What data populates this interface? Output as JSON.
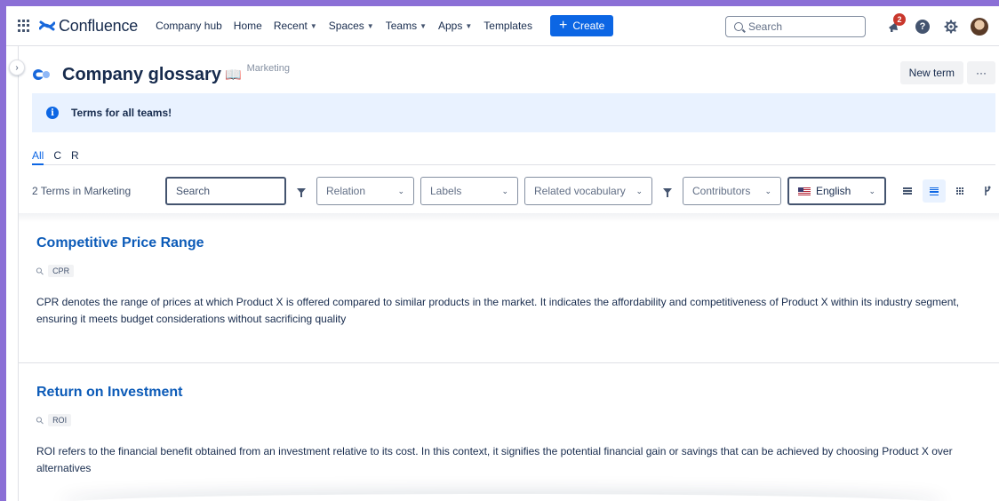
{
  "nav": {
    "brand": "Confluence",
    "items": [
      {
        "label": "Company hub",
        "dropdown": false
      },
      {
        "label": "Home",
        "dropdown": false
      },
      {
        "label": "Recent",
        "dropdown": true
      },
      {
        "label": "Spaces",
        "dropdown": true
      },
      {
        "label": "Teams",
        "dropdown": true
      },
      {
        "label": "Apps",
        "dropdown": true
      },
      {
        "label": "Templates",
        "dropdown": false
      }
    ],
    "create_label": "Create",
    "search_placeholder": "Search",
    "notification_count": "2"
  },
  "header": {
    "title": "Company glossary",
    "space": "Marketing",
    "new_term_label": "New term",
    "more_label": "···"
  },
  "banner": {
    "text": "Terms for all teams!"
  },
  "tabs": [
    {
      "label": "All",
      "active": true
    },
    {
      "label": "C",
      "active": false
    },
    {
      "label": "R",
      "active": false
    }
  ],
  "filters": {
    "count_text": "2 Terms in Marketing",
    "search_placeholder": "Search",
    "relation": "Relation",
    "labels": "Labels",
    "related_vocabulary": "Related vocabulary",
    "contributors": "Contributors",
    "language": "English"
  },
  "terms": [
    {
      "title": "Competitive Price Range",
      "abbr": "CPR",
      "description": "CPR denotes the range of prices at which Product X is offered compared to similar products in the market. It indicates the affordability and competitiveness of Product X within its industry segment, ensuring it meets budget considerations without sacrificing quality"
    },
    {
      "title": "Return on Investment",
      "abbr": "ROI",
      "description": "ROI refers to the financial benefit obtained from an investment relative to its cost. In this context, it signifies the potential financial gain or savings that can be achieved by choosing Product X over alternatives"
    }
  ],
  "colors": {
    "accent": "#0c66e4",
    "frame": "#8b6fd6",
    "banner_bg": "#e9f2ff",
    "badge": "#c9372c"
  }
}
